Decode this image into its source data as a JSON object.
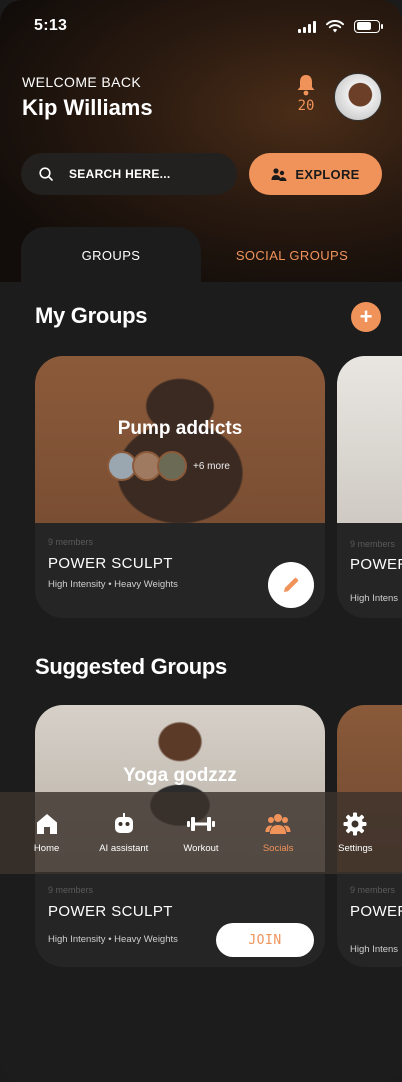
{
  "status": {
    "time": "5:13"
  },
  "header": {
    "welcome": "WELCOME BACK",
    "user_name": "Kip Williams",
    "notification_count": "20"
  },
  "search": {
    "placeholder": "SEARCH HERE..."
  },
  "explore": {
    "label": "EXPLORE"
  },
  "tabs": [
    {
      "label": "GROUPS",
      "active": true
    },
    {
      "label": "SOCIAL GROUPS",
      "active": false
    }
  ],
  "my_groups": {
    "title": "My Groups",
    "cards": [
      {
        "group_name": "Pump addicts",
        "more_members": "+6 more",
        "members": "9 members",
        "title": "POWER SCULPT",
        "tag1": "High Intensity",
        "tag2": "Heavy Weights"
      },
      {
        "members": "9 members",
        "title": "POWER",
        "tag1": "High Intens"
      }
    ]
  },
  "suggested_groups": {
    "title": "Suggested Groups",
    "cards": [
      {
        "group_name": "Yoga godzzz",
        "members": "9 members",
        "title": "POWER SCULPT",
        "tag1": "High Intensity",
        "tag2": "Heavy Weights",
        "join_label": "JOIN"
      },
      {
        "members": "9 members",
        "title": "POWER",
        "tag1": "High Intens"
      }
    ]
  },
  "nav": [
    {
      "label": "Home",
      "icon": "home-icon"
    },
    {
      "label": "AI assistant",
      "icon": "robot-icon"
    },
    {
      "label": "Workout",
      "icon": "dumbbell-icon"
    },
    {
      "label": "Socials",
      "icon": "people-icon",
      "active": true
    },
    {
      "label": "Settings",
      "icon": "gear-icon"
    }
  ],
  "colors": {
    "accent": "#f0935b",
    "background": "#1c1c1c",
    "card": "#252525"
  }
}
